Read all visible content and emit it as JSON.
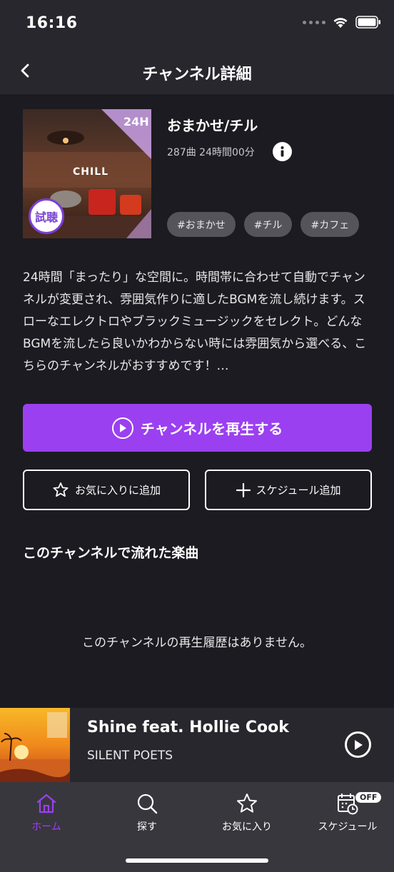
{
  "status_bar": {
    "time": "16:16"
  },
  "nav": {
    "title": "チャンネル詳細"
  },
  "channel": {
    "name": "おまかせ/チル",
    "meta": "287曲 24時間00分",
    "artwork_text": "CHILL",
    "artwork_badge": "24H",
    "trial_label": "試聴",
    "tags": [
      "#おまかせ",
      "#チル",
      "#カフェ"
    ],
    "description": "24時間「まったり」な空間に。時間帯に合わせて自動でチャンネルが変更され、雰囲気作りに適したBGMを流し続けます。スローなエレクトロやブラックミュージックをセレクト。どんなBGMを流したら良いかわからない時には雰囲気から選べる、こちらのチャンネルがおすすめです！…"
  },
  "actions": {
    "play_label": "チャンネルを再生する",
    "favorite_label": "お気に入りに追加",
    "schedule_label": "スケジュール追加"
  },
  "history": {
    "title": "このチャンネルで流れた楽曲",
    "empty_message": "このチャンネルの再生履歴はありません。"
  },
  "now_playing": {
    "title": "Shine feat. Hollie Cook",
    "artist": "SILENT POETS"
  },
  "tabs": [
    {
      "label": "ホーム",
      "icon": "home-icon",
      "active": true
    },
    {
      "label": "探す",
      "icon": "search-icon",
      "active": false
    },
    {
      "label": "お気に入り",
      "icon": "star-icon",
      "active": false
    },
    {
      "label": "スケジュール",
      "icon": "calendar-clock-icon",
      "active": false,
      "badge": "OFF"
    }
  ],
  "colors": {
    "accent": "#9b40f0",
    "background": "#1c1b21",
    "bar": "#28272d",
    "tag": "#55545a"
  }
}
